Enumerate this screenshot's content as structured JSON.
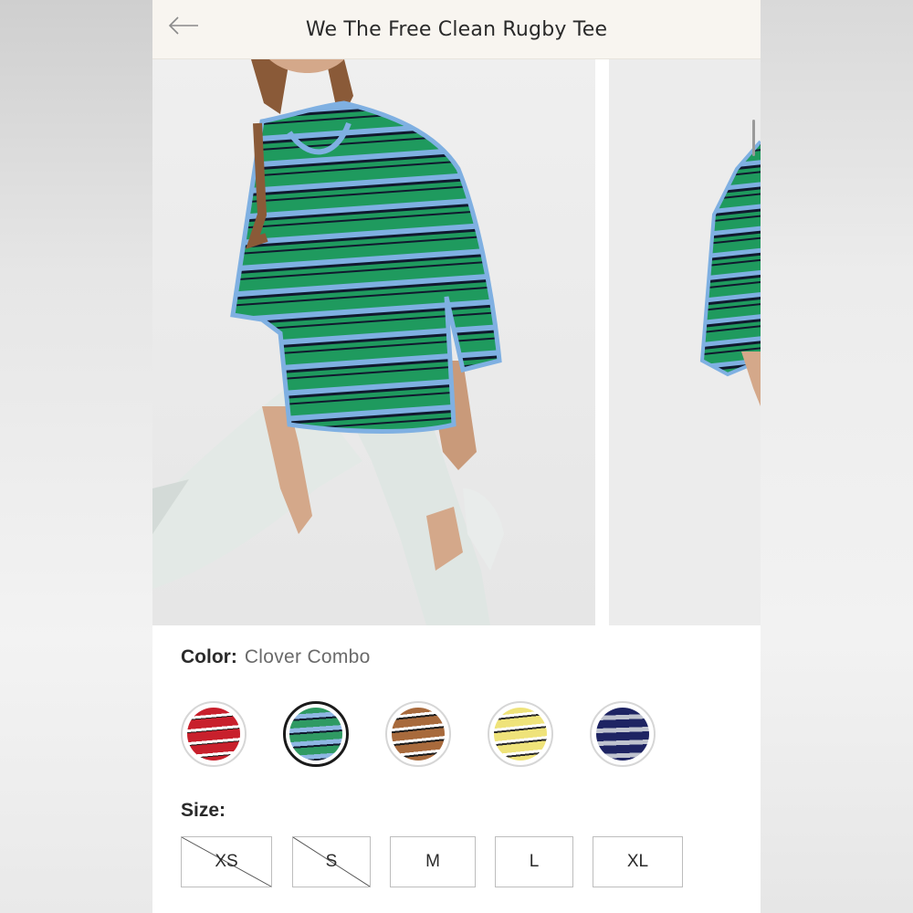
{
  "header": {
    "title": "We The Free Clean Rugby Tee",
    "back_icon": "arrow-left-icon"
  },
  "gallery": {
    "images": [
      "model-photo-front",
      "model-photo-side"
    ]
  },
  "color": {
    "label": "Color:",
    "selected_value": "Clover Combo",
    "swatches": [
      {
        "name": "red-stripe",
        "base": "#c8202c",
        "stripe": "#ffffff",
        "selected": false
      },
      {
        "name": "clover-combo",
        "base": "#2f9a63",
        "stripe": "#8fb7e3",
        "selected": true
      },
      {
        "name": "brown-stripe",
        "base": "#a86a3c",
        "stripe": "#ffffff",
        "selected": false
      },
      {
        "name": "yellow-stripe",
        "base": "#efe37a",
        "stripe": "#ffffff",
        "selected": false
      },
      {
        "name": "navy-stripe",
        "base": "#1e2463",
        "stripe": "#bfc3cf",
        "selected": false
      }
    ]
  },
  "size": {
    "label": "Size:",
    "options": [
      {
        "label": "XS",
        "available": false
      },
      {
        "label": "S",
        "available": false
      },
      {
        "label": "M",
        "available": true
      },
      {
        "label": "L",
        "available": true
      },
      {
        "label": "XL",
        "available": true
      }
    ]
  },
  "colors": {
    "shirt_green": "#1f9a5e",
    "shirt_blue": "#7fb0e2",
    "shirt_navy": "#10192e",
    "header_bg": "#f8f5f0"
  }
}
